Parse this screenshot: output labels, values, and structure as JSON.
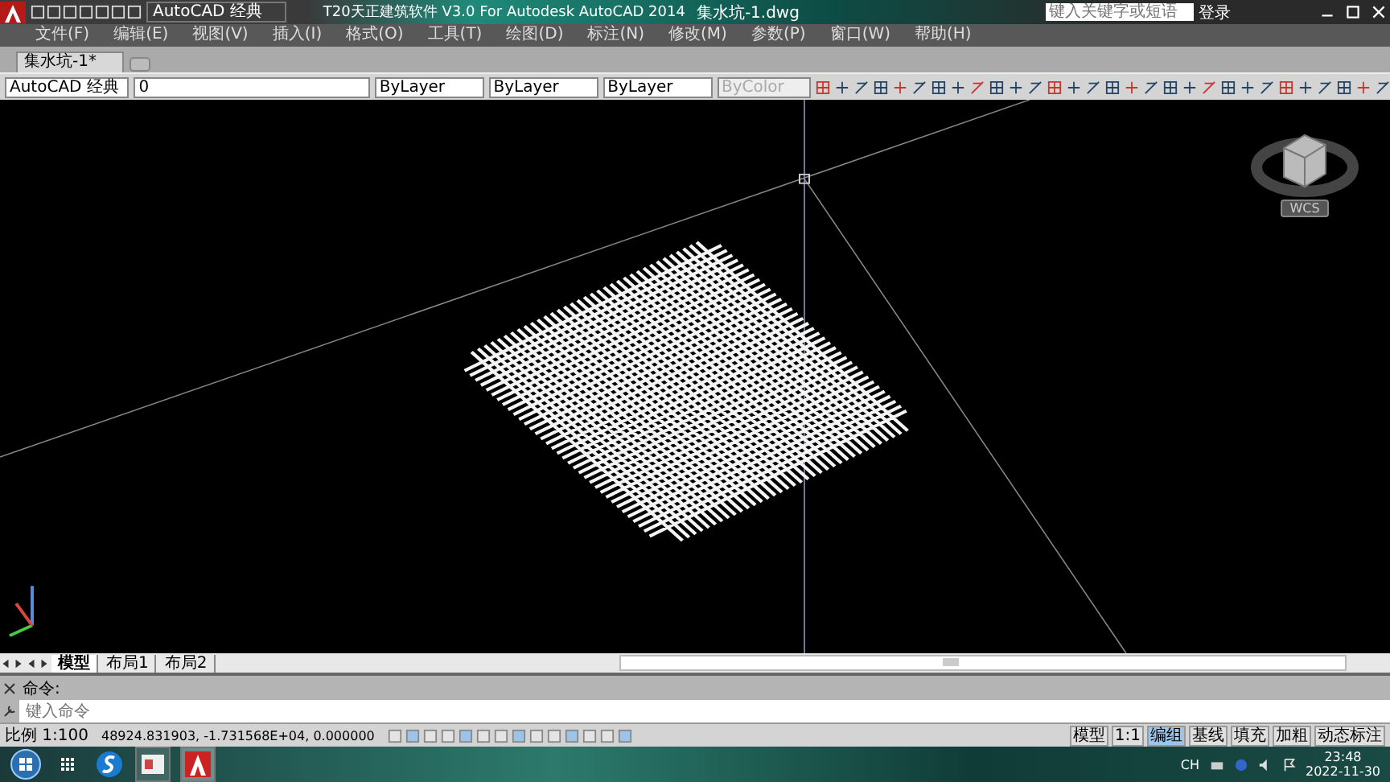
{
  "window": {
    "workspace": "AutoCAD 经典",
    "title": "T20天正建筑软件 V3.0 For Autodesk AutoCAD 2014",
    "file": "集水坑-1.dwg",
    "search_placeholder": "键入关键字或短语",
    "login": "登录"
  },
  "menu": [
    "文件(F)",
    "编辑(E)",
    "视图(V)",
    "插入(I)",
    "格式(O)",
    "工具(T)",
    "绘图(D)",
    "标注(N)",
    "修改(M)",
    "参数(P)",
    "窗口(W)",
    "帮助(H)"
  ],
  "doc_tabs": [
    {
      "label": "集水坑-1*",
      "selected": true
    }
  ],
  "toolbar": {
    "workspace": "AutoCAD 经典",
    "layer": "0",
    "color_setting": "ByLayer",
    "linetype": "ByLayer",
    "lineweight": "ByLayer",
    "plot_style": "ByColor",
    "plot_style_disabled": true
  },
  "viewcube": {
    "label": "WCS"
  },
  "layout_tabs": [
    {
      "label": "模型",
      "selected": true
    },
    {
      "label": "布局1",
      "selected": false
    },
    {
      "label": "布局2",
      "selected": false
    }
  ],
  "command": {
    "history": "命令:",
    "placeholder": "键入命令"
  },
  "status": {
    "scale": "比例 1:100",
    "coords": "48924.831903, -1.731568E+04, 0.000000",
    "model": "模型",
    "annotation_scale": "1:1",
    "toggles": [
      {
        "label": "编组",
        "on": true
      },
      {
        "label": "基线",
        "on": false
      },
      {
        "label": "填充",
        "on": false
      },
      {
        "label": "加粗",
        "on": false
      },
      {
        "label": "动态标注",
        "on": false
      }
    ]
  },
  "taskbar": {
    "language": "CH",
    "time": "23:48",
    "date": "2022-11-30"
  }
}
